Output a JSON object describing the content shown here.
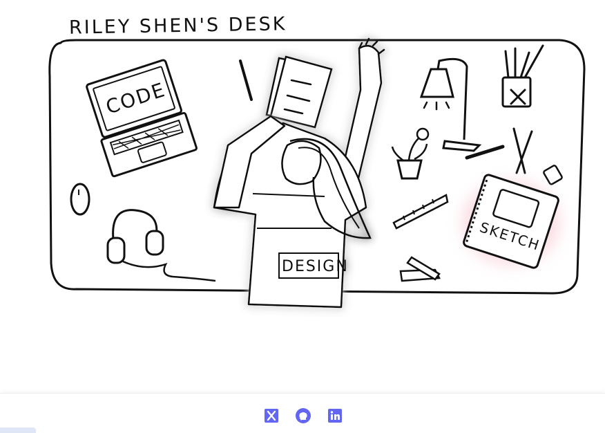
{
  "header": {
    "title": "RILEY SHEN'S DESK"
  },
  "illustration": {
    "laptop_label": "CODE",
    "shirt_label": "DESIGN",
    "sketchbook_label": "SKETCH"
  },
  "footer": {
    "links": [
      {
        "name": "x-icon",
        "color": "#6366f1"
      },
      {
        "name": "github-icon",
        "color": "#6366f1"
      },
      {
        "name": "linkedin-icon",
        "color": "#6366f1"
      }
    ]
  },
  "colors": {
    "accent": "#6366f1",
    "ink": "#111111",
    "highlight_pink": "#f7c6d0"
  }
}
